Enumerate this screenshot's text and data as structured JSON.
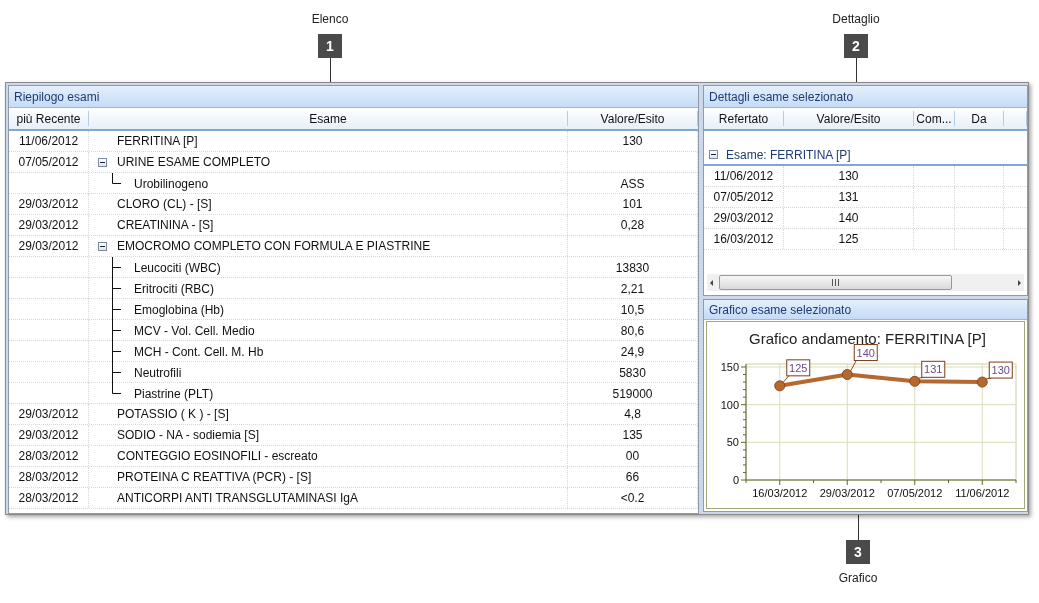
{
  "callouts": [
    {
      "number": "1",
      "label": "Elenco"
    },
    {
      "number": "2",
      "label": "Dettaglio"
    },
    {
      "number": "3",
      "label": "Grafico"
    }
  ],
  "summary": {
    "title": "Riepilogo esami",
    "columns": [
      "più Recente",
      "Esame",
      "Valore/Esito"
    ],
    "rows": [
      {
        "date": "11/06/2012",
        "exam": "FERRITINA [P]",
        "value": "130"
      },
      {
        "date": "07/05/2012",
        "exam": "URINE ESAME COMPLETO",
        "expanded": true,
        "children": [
          {
            "exam": "Urobilinogeno",
            "value": "ASS"
          }
        ]
      },
      {
        "date": "29/03/2012",
        "exam": "CLORO (CL) - [S]",
        "value": "101"
      },
      {
        "date": "29/03/2012",
        "exam": "CREATININA - [S]",
        "value": "0,28"
      },
      {
        "date": "29/03/2012",
        "exam": "EMOCROMO COMPLETO CON FORMULA E PIASTRINE",
        "expanded": true,
        "children": [
          {
            "exam": "Leucociti (WBC)",
            "value": "13830"
          },
          {
            "exam": "Eritrociti (RBC)",
            "value": "2,21"
          },
          {
            "exam": "Emoglobina (Hb)",
            "value": "10,5"
          },
          {
            "exam": "MCV - Vol. Cell. Medio",
            "value": "80,6"
          },
          {
            "exam": "MCH - Cont. Cell. M. Hb",
            "value": "24,9"
          },
          {
            "exam": "Neutrofili",
            "value": "5830"
          },
          {
            "exam": "Piastrine (PLT)",
            "value": "519000"
          }
        ]
      },
      {
        "date": "29/03/2012",
        "exam": "POTASSIO ( K ) - [S]",
        "value": "4,8"
      },
      {
        "date": "29/03/2012",
        "exam": "SODIO - NA - sodiemia [S]",
        "value": "135"
      },
      {
        "date": "28/03/2012",
        "exam": "CONTEGGIO EOSINOFILI - escreato",
        "value": "00"
      },
      {
        "date": "28/03/2012",
        "exam": "PROTEINA C REATTIVA (PCR) - [S]",
        "value": "66"
      },
      {
        "date": "28/03/2012",
        "exam": "ANTICORPI ANTI TRANSGLUTAMINASI IgA",
        "value": "<0.2"
      }
    ]
  },
  "detail": {
    "title": "Dettagli esame selezionato",
    "columns": [
      "Refertato",
      "Valore/Esito",
      "Com...",
      "Da"
    ],
    "group": {
      "label": "Esame: FERRITINA [P]",
      "expanded": true
    },
    "rows": [
      {
        "date": "11/06/2012",
        "value": "130"
      },
      {
        "date": "07/05/2012",
        "value": "131"
      },
      {
        "date": "29/03/2012",
        "value": "140"
      },
      {
        "date": "16/03/2012",
        "value": "125"
      }
    ]
  },
  "chart": {
    "title": "Grafico esame selezionato",
    "chart_data": {
      "type": "line",
      "title": "Grafico andamento: FERRITINA [P]",
      "categories": [
        "16/03/2012",
        "29/03/2012",
        "07/05/2012",
        "11/06/2012"
      ],
      "series": [
        {
          "color": "#b5692f",
          "marker": "circle",
          "values": [
            125,
            140,
            131,
            130
          ]
        }
      ],
      "ylim": [
        0,
        150
      ],
      "yticks": [
        0,
        50,
        100,
        150
      ],
      "grid": true,
      "data_labels": true
    }
  }
}
